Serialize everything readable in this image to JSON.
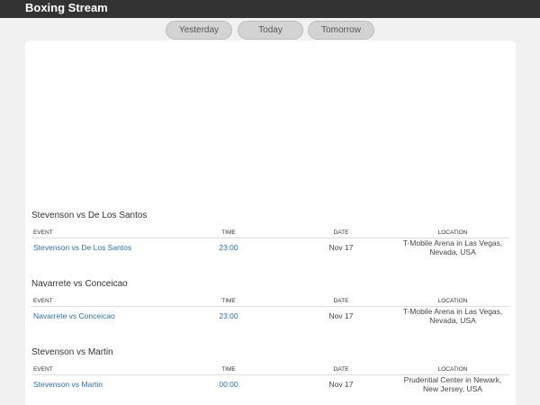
{
  "header": {
    "brand": "Boxing Stream"
  },
  "day_tabs": [
    {
      "label": "Yesterday"
    },
    {
      "label": "Today"
    },
    {
      "label": "Tomorrow"
    }
  ],
  "columns": {
    "event": "EVENT",
    "time": "TIME",
    "date": "DATE",
    "location": "LOCATION"
  },
  "events": [
    {
      "title": "Stevenson vs De Los Santos",
      "event": "Stevenson vs De Los Santos",
      "time": "23:00",
      "date": "Nov 17",
      "location": "T-Mobile Arena in Las Vegas, Nevada, USA"
    },
    {
      "title": "Navarrete vs Conceicao",
      "event": "Navarrete vs Conceicao",
      "time": "23:00",
      "date": "Nov 17",
      "location": "T-Mobile Arena in Las Vegas, Nevada, USA"
    },
    {
      "title": "Stevenson vs Martin",
      "event": "Stevenson vs Martin",
      "time": "00:00",
      "date": "Nov 17",
      "location": "Prudential Center in Newark, New Jersey, USA"
    }
  ]
}
